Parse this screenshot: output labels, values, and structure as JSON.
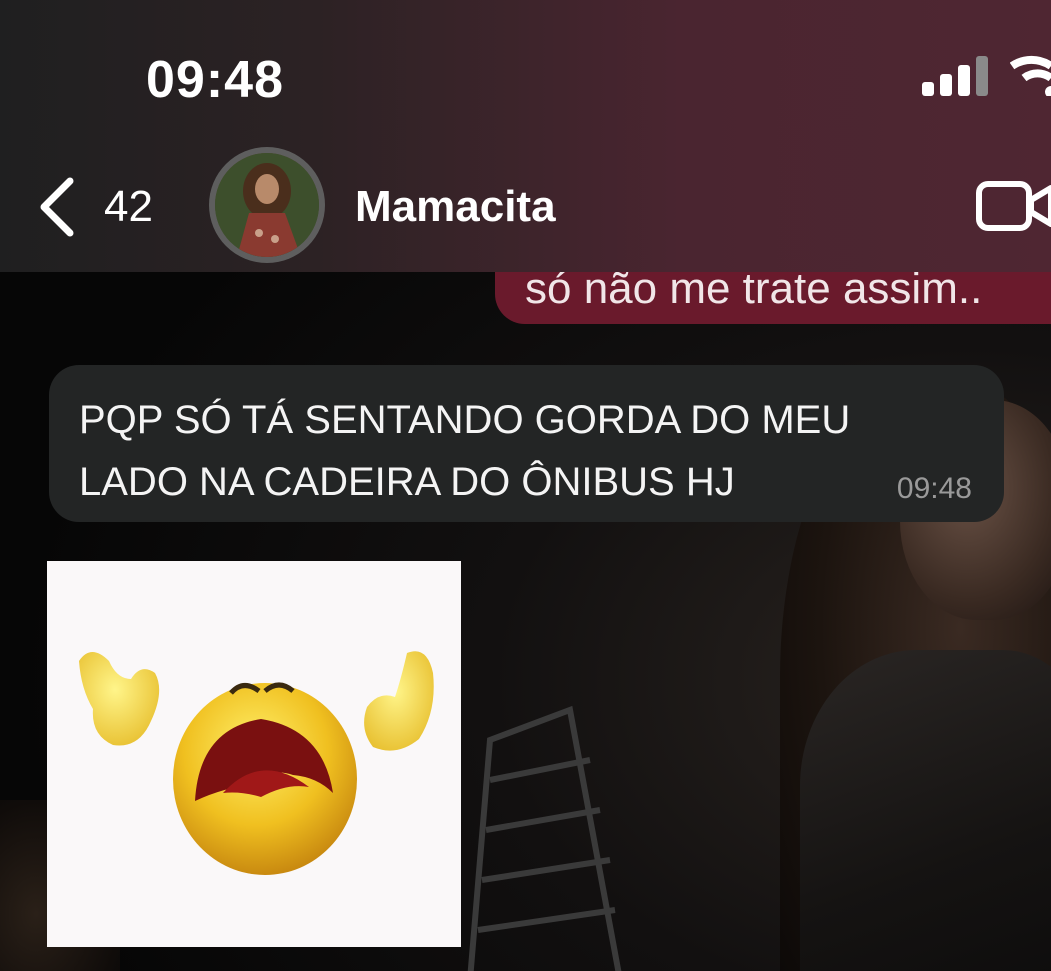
{
  "status_bar": {
    "time": "09:48",
    "signal_icon": "cellular-signal-icon",
    "wifi_icon": "wifi-icon"
  },
  "header": {
    "back_icon": "chevron-left-icon",
    "unread_count": "42",
    "contact_name": "Mamacita",
    "video_icon": "video-camera-icon"
  },
  "messages": [
    {
      "direction": "outgoing",
      "text": "só não me trate assim.."
    },
    {
      "direction": "incoming",
      "lines": [
        "PQP SÓ TÁ SENTANDO GORDA DO MEU",
        "LADO NA CADEIRA DO ÔNIBUS HJ"
      ],
      "time": "09:48"
    },
    {
      "direction": "incoming",
      "type": "sticker",
      "sticker": "crying-emoji-sticker"
    }
  ],
  "colors": {
    "outgoing_bubble": "#6a1a2c",
    "incoming_bubble": "#232525",
    "header_accent": "#4f2632"
  }
}
